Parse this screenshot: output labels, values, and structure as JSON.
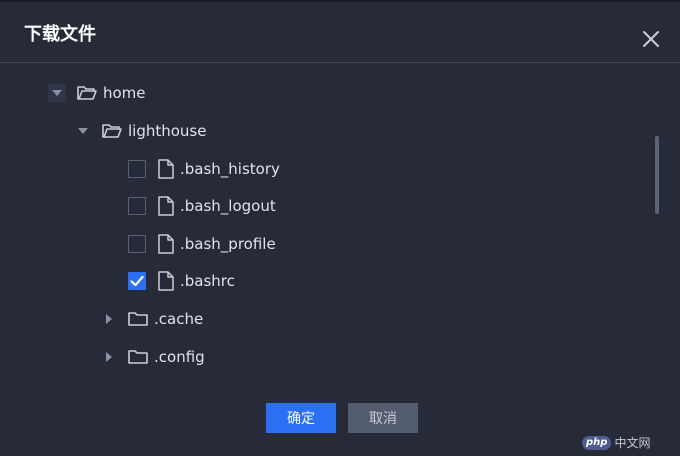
{
  "dialog": {
    "title": "下载文件",
    "close_icon": "close-icon"
  },
  "tree": {
    "root": {
      "label": "home",
      "expanded": true,
      "icon": "folder-open-icon"
    },
    "child": {
      "label": "lighthouse",
      "expanded": true,
      "icon": "folder-open-icon"
    },
    "files": [
      {
        "label": ".bash_history",
        "checked": false,
        "icon": "file-icon"
      },
      {
        "label": ".bash_logout",
        "checked": false,
        "icon": "file-icon"
      },
      {
        "label": ".bash_profile",
        "checked": false,
        "icon": "file-icon"
      },
      {
        "label": ".bashrc",
        "checked": true,
        "icon": "file-icon"
      }
    ],
    "folders": [
      {
        "label": ".cache",
        "expanded": false,
        "icon": "folder-icon"
      },
      {
        "label": ".config",
        "expanded": false,
        "icon": "folder-icon"
      }
    ]
  },
  "buttons": {
    "confirm_label": "确定",
    "cancel_label": "取消"
  },
  "watermark": {
    "badge": "php",
    "text": "中文网"
  },
  "colors": {
    "background": "#262b37",
    "accent": "#2b6ff5",
    "secondary_button": "#545d70",
    "text": "#dfe3ea"
  }
}
